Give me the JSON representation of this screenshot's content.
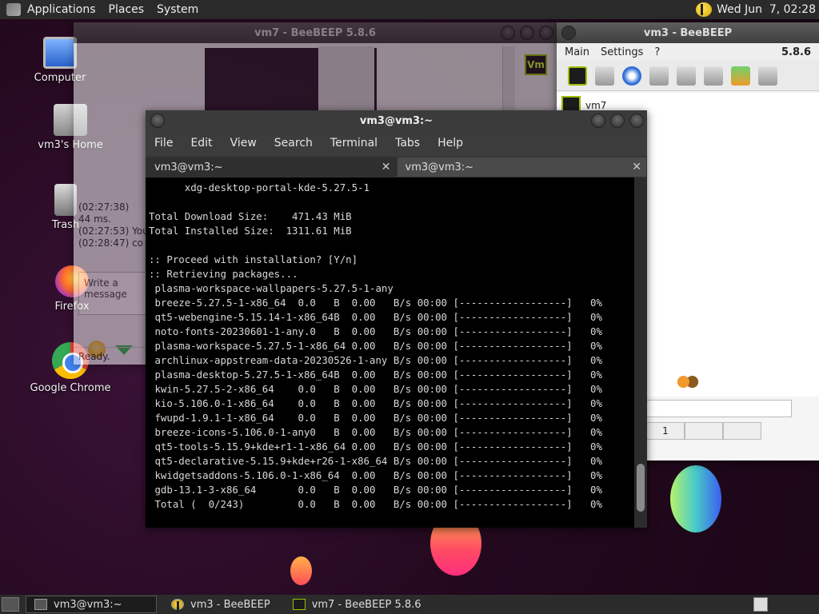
{
  "top_panel": {
    "menus": [
      "Applications",
      "Places",
      "System"
    ],
    "clock": "Wed Jun  7, 02:28"
  },
  "desktop_icons": [
    {
      "label": "Computer",
      "icon": "computer-icon"
    },
    {
      "label": "vm3's Home",
      "icon": "home-folder-icon"
    },
    {
      "label": "Trash",
      "icon": "trash-icon"
    },
    {
      "label": "Firefox",
      "icon": "firefox-icon"
    },
    {
      "label": "Google Chrome",
      "icon": "chrome-icon"
    }
  ],
  "vm7_window": {
    "title": "vm7 - BeeBEEP 5.8.6",
    "chat_lines": [
      "(02:27:38)",
      "44 ms.",
      "(02:27:53) You",
      "(02:28:47) co"
    ],
    "message_placeholder": "Write a message",
    "status": "Ready.",
    "vm_badge": "Vm"
  },
  "vm3_window": {
    "title": "vm3 - BeeBEEP",
    "menu": [
      "Main",
      "Settings",
      "?"
    ],
    "version": "5.8.6",
    "users": [
      {
        "name": "vm7"
      }
    ],
    "footer": [
      "1"
    ]
  },
  "terminal": {
    "title": "vm3@vm3:~",
    "menu": [
      "File",
      "Edit",
      "View",
      "Search",
      "Terminal",
      "Tabs",
      "Help"
    ],
    "tabs": [
      {
        "label": "vm3@vm3:~",
        "active": true
      },
      {
        "label": "vm3@vm3:~",
        "active": false
      }
    ],
    "output": "      xdg-desktop-portal-kde-5.27.5-1\n\nTotal Download Size:    471.43 MiB\nTotal Installed Size:  1311.61 MiB\n\n:: Proceed with installation? [Y/n]\n:: Retrieving packages...\n plasma-workspace-wallpapers-5.27.5-1-any\n breeze-5.27.5-1-x86_64  0.0   B  0.00   B/s 00:00 [------------------]   0%\n qt5-webengine-5.15.14-1-x86_64B  0.00   B/s 00:00 [------------------]   0%\n noto-fonts-20230601-1-any.0   B  0.00   B/s 00:00 [------------------]   0%\n plasma-workspace-5.27.5-1-x86_64 0.00   B/s 00:00 [------------------]   0%\n archlinux-appstream-data-20230526-1-any B/s 00:00 [------------------]   0%\n plasma-desktop-5.27.5-1-x86_64B  0.00   B/s 00:00 [------------------]   0%\n kwin-5.27.5-2-x86_64    0.0   B  0.00   B/s 00:00 [------------------]   0%\n kio-5.106.0-1-x86_64    0.0   B  0.00   B/s 00:00 [------------------]   0%\n fwupd-1.9.1-1-x86_64    0.0   B  0.00   B/s 00:00 [------------------]   0%\n breeze-icons-5.106.0-1-any0   B  0.00   B/s 00:00 [------------------]   0%\n qt5-tools-5.15.9+kde+r1-1-x86_64 0.00   B/s 00:00 [------------------]   0%\n qt5-declarative-5.15.9+kde+r26-1-x86_64 B/s 00:00 [------------------]   0%\n kwidgetsaddons-5.106.0-1-x86_64  0.00   B/s 00:00 [------------------]   0%\n gdb-13.1-3-x86_64       0.0   B  0.00   B/s 00:00 [------------------]   0%\n Total (  0/243)         0.0   B  0.00   B/s 00:00 [------------------]   0%"
  },
  "taskbar": [
    {
      "label": "vm3@vm3:~",
      "icon": "terminal-icon",
      "active": true
    },
    {
      "label": "vm3 - BeeBEEP",
      "icon": "beebeep-icon",
      "active": false
    },
    {
      "label": "vm7 - BeeBEEP 5.8.6",
      "icon": "vm-icon",
      "active": false
    }
  ]
}
